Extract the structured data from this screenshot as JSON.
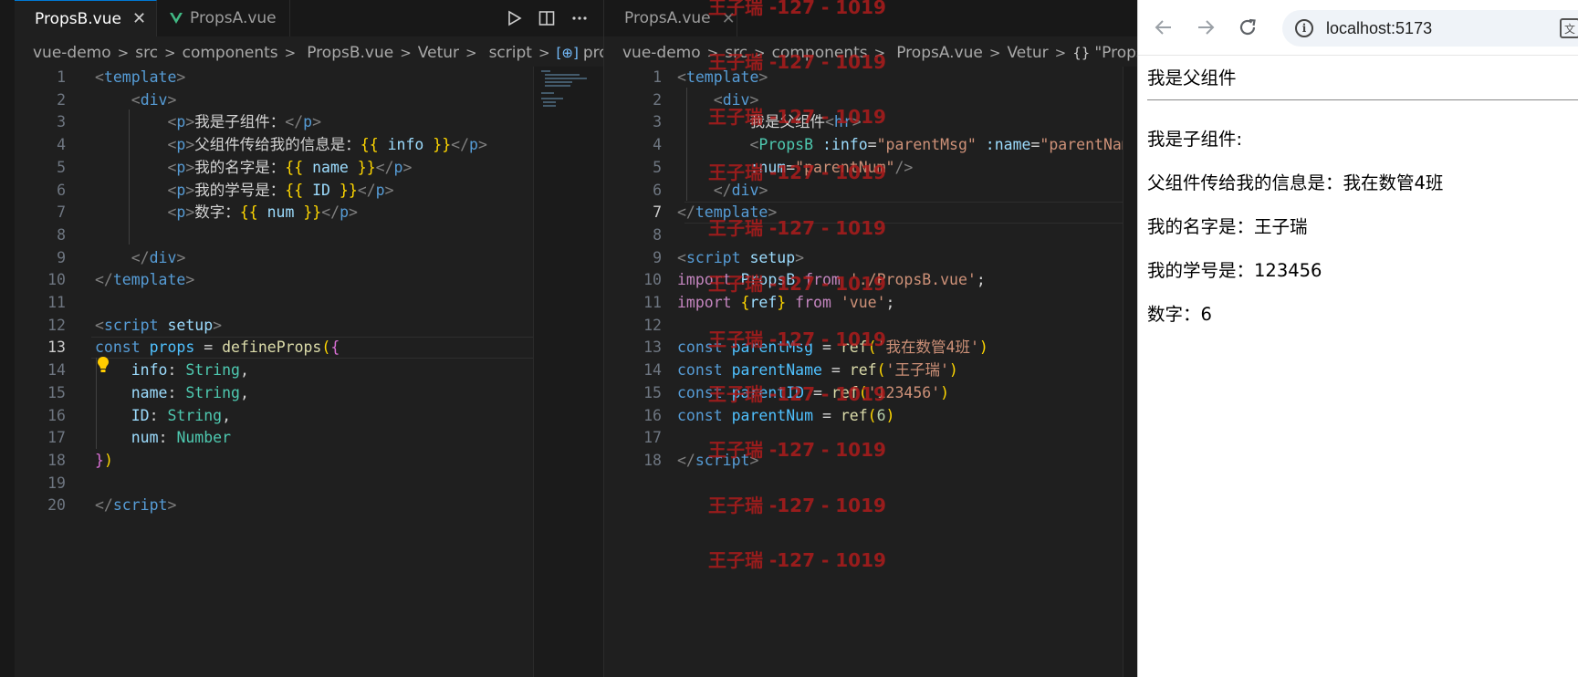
{
  "colors": {
    "editor_bg": "#1f1f1f",
    "tab_bar_bg": "#181818",
    "accent": "#0078d4",
    "watermark": "#b71c1c",
    "vue_green": "#41b883"
  },
  "editor_b": {
    "tabs": [
      {
        "label": "PropsB.vue",
        "active": true,
        "icon": "vue-icon",
        "close": "✕"
      },
      {
        "label": "PropsA.vue",
        "active": false,
        "icon": "vue-icon"
      }
    ],
    "actions": [
      "run-icon",
      "split-editor-icon",
      "more-actions-icon"
    ],
    "breadcrumb": [
      "vue-demo",
      "src",
      "components",
      "PropsB.vue",
      "Vetur",
      "script",
      "props"
    ],
    "current_line": 13,
    "lines": [
      [
        [
          "tag-br",
          "<"
        ],
        [
          "tag",
          "template"
        ],
        [
          "tag-br",
          ">"
        ]
      ],
      [
        [
          "plain",
          "    "
        ],
        [
          "tag-br",
          "<"
        ],
        [
          "tag",
          "div"
        ],
        [
          "tag-br",
          ">"
        ]
      ],
      [
        [
          "plain",
          "        "
        ],
        [
          "tag-br",
          "<"
        ],
        [
          "tag",
          "p"
        ],
        [
          "tag-br",
          ">"
        ],
        [
          "plain",
          "我是子组件："
        ],
        [
          "tag-br",
          "</"
        ],
        [
          "tag",
          "p"
        ],
        [
          "tag-br",
          ">"
        ]
      ],
      [
        [
          "plain",
          "        "
        ],
        [
          "tag-br",
          "<"
        ],
        [
          "tag",
          "p"
        ],
        [
          "tag-br",
          ">"
        ],
        [
          "plain",
          "父组件传给我的信息是："
        ],
        [
          "mus",
          "{{"
        ],
        [
          "vr",
          " info "
        ],
        [
          "mus",
          "}}"
        ],
        [
          "tag-br",
          "</"
        ],
        [
          "tag",
          "p"
        ],
        [
          "tag-br",
          ">"
        ]
      ],
      [
        [
          "plain",
          "        "
        ],
        [
          "tag-br",
          "<"
        ],
        [
          "tag",
          "p"
        ],
        [
          "tag-br",
          ">"
        ],
        [
          "plain",
          "我的名字是："
        ],
        [
          "mus",
          "{{"
        ],
        [
          "vr",
          " name "
        ],
        [
          "mus",
          "}}"
        ],
        [
          "tag-br",
          "</"
        ],
        [
          "tag",
          "p"
        ],
        [
          "tag-br",
          ">"
        ]
      ],
      [
        [
          "plain",
          "        "
        ],
        [
          "tag-br",
          "<"
        ],
        [
          "tag",
          "p"
        ],
        [
          "tag-br",
          ">"
        ],
        [
          "plain",
          "我的学号是："
        ],
        [
          "mus",
          "{{"
        ],
        [
          "vr",
          " ID "
        ],
        [
          "mus",
          "}}"
        ],
        [
          "tag-br",
          "</"
        ],
        [
          "tag",
          "p"
        ],
        [
          "tag-br",
          ">"
        ]
      ],
      [
        [
          "plain",
          "        "
        ],
        [
          "tag-br",
          "<"
        ],
        [
          "tag",
          "p"
        ],
        [
          "tag-br",
          ">"
        ],
        [
          "plain",
          "数字："
        ],
        [
          "mus",
          "{{"
        ],
        [
          "vr",
          " num "
        ],
        [
          "mus",
          "}}"
        ],
        [
          "tag-br",
          "</"
        ],
        [
          "tag",
          "p"
        ],
        [
          "tag-br",
          ">"
        ]
      ],
      [],
      [
        [
          "plain",
          "    "
        ],
        [
          "tag-br",
          "</"
        ],
        [
          "tag",
          "div"
        ],
        [
          "tag-br",
          ">"
        ]
      ],
      [
        [
          "tag-br",
          "</"
        ],
        [
          "tag",
          "template"
        ],
        [
          "tag-br",
          ">"
        ]
      ],
      [],
      [
        [
          "tag-br",
          "<"
        ],
        [
          "tag",
          "script"
        ],
        [
          "plain",
          " "
        ],
        [
          "attr",
          "setup"
        ],
        [
          "tag-br",
          ">"
        ]
      ],
      [
        [
          "kw",
          "const"
        ],
        [
          "plain",
          " "
        ],
        [
          "var",
          "props"
        ],
        [
          "plain",
          " = "
        ],
        [
          "fn",
          "defineProps"
        ],
        [
          "br1",
          "("
        ],
        [
          "br2",
          "{"
        ]
      ],
      [
        [
          "plain",
          "    "
        ],
        [
          "vr",
          "info"
        ],
        [
          "plain",
          ": "
        ],
        [
          "type",
          "String"
        ],
        [
          "plain",
          ","
        ]
      ],
      [
        [
          "plain",
          "    "
        ],
        [
          "vr",
          "name"
        ],
        [
          "plain",
          ": "
        ],
        [
          "type",
          "String"
        ],
        [
          "plain",
          ","
        ]
      ],
      [
        [
          "plain",
          "    "
        ],
        [
          "vr",
          "ID"
        ],
        [
          "plain",
          ": "
        ],
        [
          "type",
          "String"
        ],
        [
          "plain",
          ","
        ]
      ],
      [
        [
          "plain",
          "    "
        ],
        [
          "vr",
          "num"
        ],
        [
          "plain",
          ": "
        ],
        [
          "type",
          "Number"
        ]
      ],
      [
        [
          "br2",
          "}"
        ],
        [
          "br1",
          ")"
        ]
      ],
      [],
      [
        [
          "tag-br",
          "</"
        ],
        [
          "tag",
          "script"
        ],
        [
          "tag-br",
          ">"
        ]
      ]
    ]
  },
  "editor_a": {
    "tabs": [
      {
        "label": "PropsA.vue",
        "active": false,
        "icon": "vue-icon",
        "close": "✕"
      }
    ],
    "breadcrumb": [
      "vue-demo",
      "src",
      "components",
      "PropsA.vue",
      "Vetur",
      "\"PropsA.vue\""
    ],
    "current_line": 7,
    "lines": [
      [
        [
          "tag-br",
          "<"
        ],
        [
          "tag",
          "template"
        ],
        [
          "tag-br",
          ">"
        ]
      ],
      [
        [
          "plain",
          "    "
        ],
        [
          "tag-br",
          "<"
        ],
        [
          "tag",
          "div"
        ],
        [
          "tag-br",
          ">"
        ]
      ],
      [
        [
          "plain",
          "        我是父组件"
        ],
        [
          "tag-br",
          "<"
        ],
        [
          "tag",
          "hr"
        ],
        [
          "tag-br",
          ">"
        ]
      ],
      [
        [
          "plain",
          "        "
        ],
        [
          "tag-br",
          "<"
        ],
        [
          "type",
          "PropsB"
        ],
        [
          "plain",
          " "
        ],
        [
          "attr",
          ":info"
        ],
        [
          "plain",
          "="
        ],
        [
          "str",
          "\"parentMsg\""
        ],
        [
          "plain",
          " "
        ],
        [
          "attr",
          ":name"
        ],
        [
          "plain",
          "="
        ],
        [
          "str",
          "\"parentNam"
        ]
      ],
      [
        [
          "plain",
          "        "
        ],
        [
          "attr",
          ":num"
        ],
        [
          "plain",
          "="
        ],
        [
          "str",
          "\"parentNum\""
        ],
        [
          "tag-br",
          "/>"
        ]
      ],
      [
        [
          "plain",
          "    "
        ],
        [
          "tag-br",
          "</"
        ],
        [
          "tag",
          "div"
        ],
        [
          "tag-br",
          ">"
        ]
      ],
      [
        [
          "tag-br",
          "</"
        ],
        [
          "tag",
          "template"
        ],
        [
          "tag-br",
          ">"
        ]
      ],
      [],
      [
        [
          "tag-br",
          "<"
        ],
        [
          "tag",
          "script"
        ],
        [
          "plain",
          " "
        ],
        [
          "attr",
          "setup"
        ],
        [
          "tag-br",
          ">"
        ]
      ],
      [
        [
          "kw2",
          "import"
        ],
        [
          "plain",
          " "
        ],
        [
          "vr",
          "PropsB"
        ],
        [
          "plain",
          " "
        ],
        [
          "kw2",
          "from"
        ],
        [
          "plain",
          " "
        ],
        [
          "str",
          "'./PropsB.vue'"
        ],
        [
          "plain",
          ";"
        ]
      ],
      [
        [
          "kw2",
          "import"
        ],
        [
          "plain",
          " "
        ],
        [
          "br1",
          "{"
        ],
        [
          "vr",
          "ref"
        ],
        [
          "br1",
          "}"
        ],
        [
          "plain",
          " "
        ],
        [
          "kw2",
          "from"
        ],
        [
          "plain",
          " "
        ],
        [
          "str",
          "'vue'"
        ],
        [
          "plain",
          ";"
        ]
      ],
      [],
      [
        [
          "kw",
          "const"
        ],
        [
          "plain",
          " "
        ],
        [
          "var",
          "parentMsg"
        ],
        [
          "plain",
          " = "
        ],
        [
          "fn",
          "ref"
        ],
        [
          "br1",
          "("
        ],
        [
          "str",
          "'我在数管4班'"
        ],
        [
          "br1",
          ")"
        ]
      ],
      [
        [
          "kw",
          "const"
        ],
        [
          "plain",
          " "
        ],
        [
          "var",
          "parentName"
        ],
        [
          "plain",
          " = "
        ],
        [
          "fn",
          "ref"
        ],
        [
          "br1",
          "("
        ],
        [
          "str",
          "'王子瑞'"
        ],
        [
          "br1",
          ")"
        ]
      ],
      [
        [
          "kw",
          "const"
        ],
        [
          "plain",
          " "
        ],
        [
          "var",
          "parentID"
        ],
        [
          "plain",
          " = "
        ],
        [
          "fn",
          "ref"
        ],
        [
          "br1",
          "("
        ],
        [
          "str",
          "'123456'"
        ],
        [
          "br1",
          ")"
        ]
      ],
      [
        [
          "kw",
          "const"
        ],
        [
          "plain",
          " "
        ],
        [
          "var",
          "parentNum"
        ],
        [
          "plain",
          " = "
        ],
        [
          "fn",
          "ref"
        ],
        [
          "br1",
          "("
        ],
        [
          "num",
          "6"
        ],
        [
          "br1",
          ")"
        ]
      ],
      [],
      [
        [
          "tag-br",
          "</"
        ],
        [
          "tag",
          "script"
        ],
        [
          "tag-br",
          ">"
        ]
      ]
    ]
  },
  "watermark": "王子瑞 -127 - 1019",
  "browser": {
    "url": "localhost:5173",
    "translate_glyph": "文",
    "heading": "我是父组件",
    "lines": [
      "我是子组件:",
      "父组件传给我的信息是：我在数管4班",
      "我的名字是：王子瑞",
      "我的学号是：123456",
      "数字：6"
    ]
  }
}
